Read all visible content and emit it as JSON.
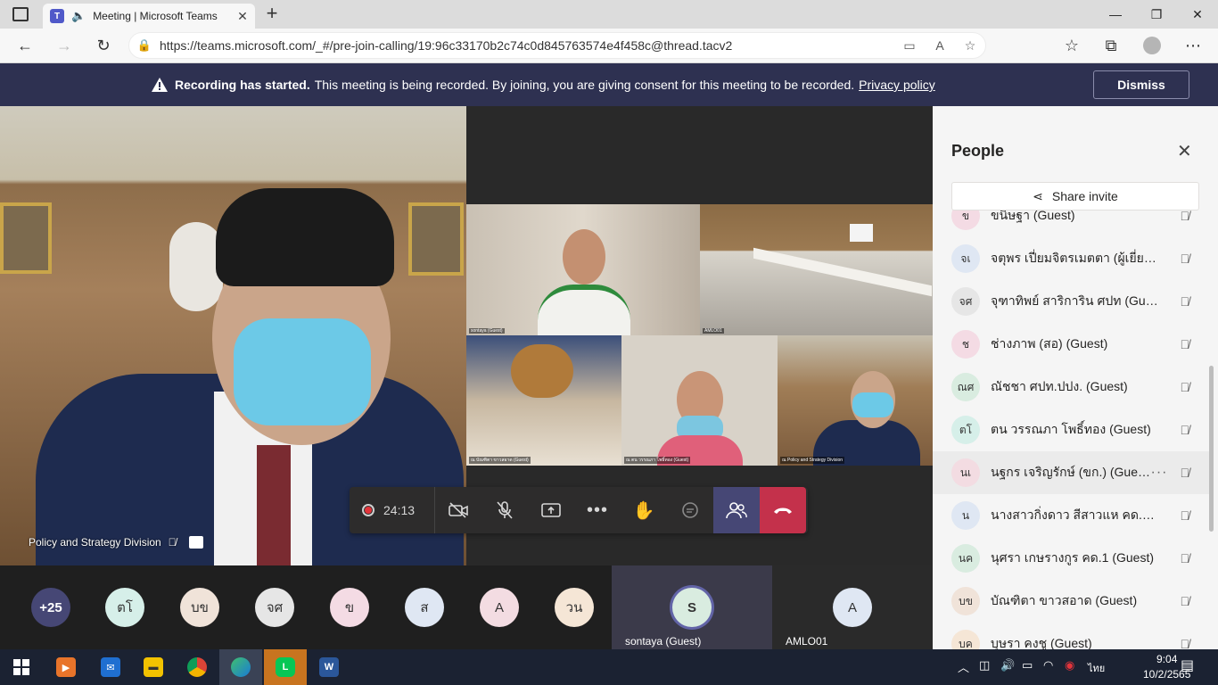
{
  "browser": {
    "tab_title": "Meeting | Microsoft Teams",
    "url": "https://teams.microsoft.com/_#/pre-join-calling/19:96c33170b2c74c0d845763574e4f458c@thread.tacv2"
  },
  "banner": {
    "bold": "Recording has started.",
    "text": "This meeting is being recorded. By joining, you are giving consent for this meeting to be recorded.",
    "link": "Privacy policy",
    "dismiss": "Dismiss"
  },
  "stage": {
    "main_label": "Policy and Strategy Division",
    "tiles": [
      {
        "label": "sontaya (Guest)"
      },
      {
        "label": "AMLO01"
      },
      {
        "label": "ณ บัณฑิตา ขาวสอาด (Guest)"
      },
      {
        "label": "ณ ตน วรรณภา โพธิ์ทอง (Guest)"
      },
      {
        "label": "ณ Policy and Strategy Division"
      }
    ]
  },
  "controls": {
    "timer": "24:13"
  },
  "strip": {
    "count": "+25",
    "avatars": [
      {
        "initials": "ตโ",
        "bg": "#d6efe9"
      },
      {
        "initials": "บข",
        "bg": "#f0e3d9"
      },
      {
        "initials": "จศ",
        "bg": "#e6e6e6"
      },
      {
        "initials": "ข",
        "bg": "#f4dbe4"
      },
      {
        "initials": "ส",
        "bg": "#dfe7f3"
      },
      {
        "initials": "A",
        "bg": "#f3dce2"
      },
      {
        "initials": "วน",
        "bg": "#f5e6d6"
      }
    ],
    "spotlight": [
      {
        "initials": "S",
        "name": "sontaya (Guest)"
      },
      {
        "initials": "A",
        "name": "AMLO01"
      }
    ]
  },
  "people": {
    "title": "People",
    "share_invite": "Share invite",
    "rows": [
      {
        "initials": "ข",
        "name": "ขนิษฐา (Guest)",
        "bg": "#f4dbe4"
      },
      {
        "initials": "จเ",
        "name": "จตุพร เปี่ยมจิตรเมตตา (ผู้เยี่ยม...",
        "bg": "#dfe7f3"
      },
      {
        "initials": "จศ",
        "name": "จุฑาทิพย์ สาริการิน ศปท (Gue...",
        "bg": "#e6e6e6"
      },
      {
        "initials": "ช",
        "name": "ช่างภาพ (สอ) (Guest)",
        "bg": "#f4dbe4"
      },
      {
        "initials": "ณศ",
        "name": "ณัชชา ศปท.ปปง. (Guest)",
        "bg": "#d9ece0"
      },
      {
        "initials": "ตโ",
        "name": "ตน วรรณภา โพธิ์ทอง (Guest)",
        "bg": "#d6efe9"
      },
      {
        "initials": "นเ",
        "name": "นฐกร เจริญรักษ์ (ขก.) (Guest)",
        "bg": "#f3dce2"
      },
      {
        "initials": "น",
        "name": "นางสาวกิ่งดาว สีสาวแห คด.4 (...",
        "bg": "#dfe7f3"
      },
      {
        "initials": "นค",
        "name": "นุศรา เกษรางกูร คด.1 (Guest)",
        "bg": "#d9ece0"
      },
      {
        "initials": "บข",
        "name": "บัณฑิตา ขาวสอาด (Guest)",
        "bg": "#f0e3d9"
      },
      {
        "initials": "บค",
        "name": "บุษรา คงชู (Guest)",
        "bg": "#f5e6d6"
      }
    ]
  },
  "taskbar": {
    "lang": "ไทย",
    "time": "9:04",
    "date": "10/2/2565"
  }
}
